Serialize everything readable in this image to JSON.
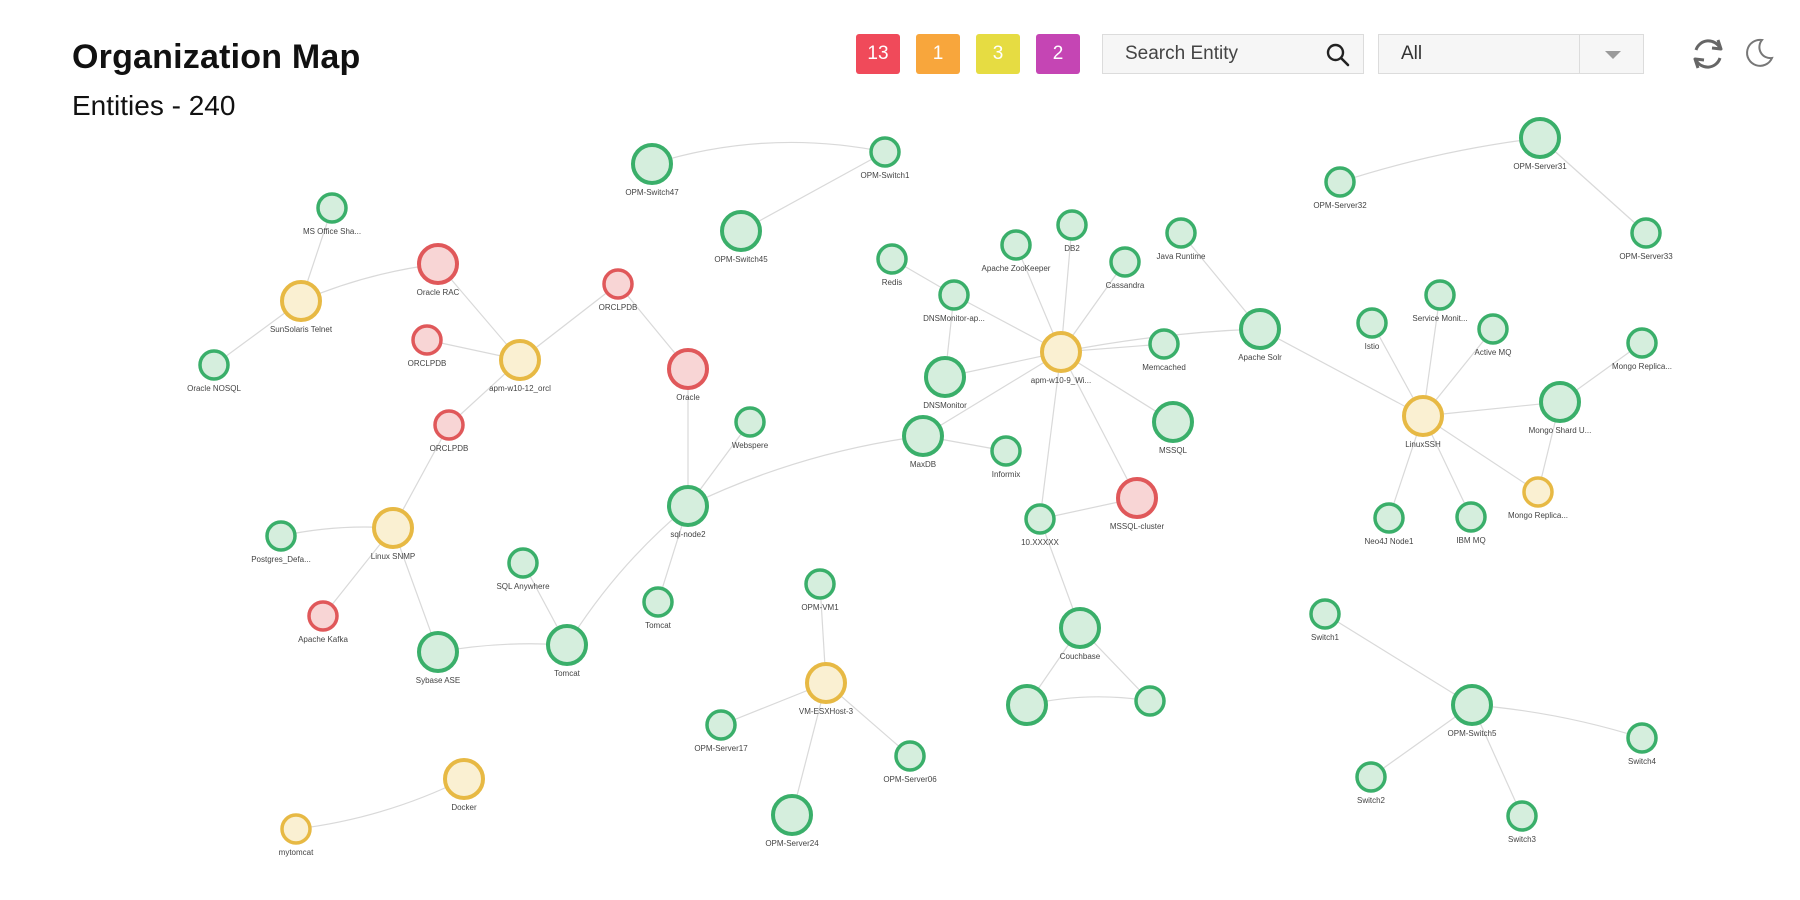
{
  "header": {
    "title": "Organization Map",
    "subtitle": "Entities - 240"
  },
  "status_counts": [
    {
      "value": "13",
      "color": "#f04a5a"
    },
    {
      "value": "1",
      "color": "#f8a63c"
    },
    {
      "value": "3",
      "color": "#e6dc42"
    },
    {
      "value": "2",
      "color": "#c545b4"
    }
  ],
  "search": {
    "placeholder": "Search Entity",
    "icon": "search-icon"
  },
  "filter": {
    "selected": "All",
    "icon": "chevron-down-icon"
  },
  "toolbar": {
    "refresh_icon": "refresh-icon",
    "theme_icon": "moon-icon"
  },
  "colors": {
    "green": "#3aaf6a",
    "green_fill": "#d5eedd",
    "red": "#e0585a",
    "red_fill": "#f8d5d5",
    "yellow": "#e7b944",
    "yellow_fill": "#faf0d2",
    "edge": "#d9d9d9"
  },
  "nodes": [
    {
      "id": "n1",
      "label": "OPM-Switch47",
      "status": "green"
    },
    {
      "id": "n2",
      "label": "OPM-Switch1",
      "status": "green"
    },
    {
      "id": "n3",
      "label": "OPM-Switch45",
      "status": "green"
    },
    {
      "id": "n4",
      "label": "MS Office Sha...",
      "status": "green"
    },
    {
      "id": "n5",
      "label": "Oracle RAC",
      "status": "red"
    },
    {
      "id": "n6",
      "label": "SunSolaris Telnet",
      "status": "yellow"
    },
    {
      "id": "n7",
      "label": "Oracle NOSQL",
      "status": "green"
    },
    {
      "id": "n8",
      "label": "ORCLPDB",
      "status": "red"
    },
    {
      "id": "n9",
      "label": "apm-w10-12_orcl",
      "status": "yellow"
    },
    {
      "id": "n10",
      "label": "ORCLPDB",
      "status": "red"
    },
    {
      "id": "n11",
      "label": "Oracle",
      "status": "red"
    },
    {
      "id": "n12",
      "label": "ORCLPDB",
      "status": "red"
    },
    {
      "id": "n13",
      "label": "Linux SNMP",
      "status": "yellow"
    },
    {
      "id": "n14",
      "label": "Postgres_Defa...",
      "status": "green"
    },
    {
      "id": "n15",
      "label": "Apache Kafka",
      "status": "red"
    },
    {
      "id": "n16",
      "label": "Sybase ASE",
      "status": "green"
    },
    {
      "id": "n17",
      "label": "SQL Anywhere",
      "status": "green"
    },
    {
      "id": "n18",
      "label": "Tomcat",
      "status": "green"
    },
    {
      "id": "n19",
      "label": "sql-node2",
      "status": "green"
    },
    {
      "id": "n20",
      "label": "Webspere",
      "status": "green"
    },
    {
      "id": "n21",
      "label": "Tomcat",
      "status": "green"
    },
    {
      "id": "n22",
      "label": "Docker",
      "status": "yellow"
    },
    {
      "id": "n23",
      "label": "mytomcat",
      "status": "yellow"
    },
    {
      "id": "n24",
      "label": "Redis",
      "status": "green"
    },
    {
      "id": "n25",
      "label": "Apache ZooKeeper",
      "status": "green"
    },
    {
      "id": "n26",
      "label": "DB2",
      "status": "green"
    },
    {
      "id": "n27",
      "label": "Cassandra",
      "status": "green"
    },
    {
      "id": "n28",
      "label": "Java Runtime",
      "status": "green"
    },
    {
      "id": "n29",
      "label": "DNSMonitor-ap...",
      "status": "green"
    },
    {
      "id": "n30",
      "label": "apm-w10-9_Wi...",
      "status": "yellow"
    },
    {
      "id": "n31",
      "label": "Memcached",
      "status": "green"
    },
    {
      "id": "n32",
      "label": "Apache Solr",
      "status": "green"
    },
    {
      "id": "n33",
      "label": "DNSMonitor",
      "status": "green"
    },
    {
      "id": "n34",
      "label": "MaxDB",
      "status": "green"
    },
    {
      "id": "n35",
      "label": "Informix",
      "status": "green"
    },
    {
      "id": "n36",
      "label": "MSSQL",
      "status": "green"
    },
    {
      "id": "n37",
      "label": "MSSQL-cluster",
      "status": "red"
    },
    {
      "id": "n38",
      "label": "10.XXXXX",
      "status": "green"
    },
    {
      "id": "n39",
      "label": "Couchbase",
      "status": "green"
    },
    {
      "id": "n40",
      "label": "",
      "status": "green"
    },
    {
      "id": "n41",
      "label": "",
      "status": "green"
    },
    {
      "id": "n42",
      "label": "OPM-VM1",
      "status": "green"
    },
    {
      "id": "n43",
      "label": "VM-ESXHost-3",
      "status": "yellow"
    },
    {
      "id": "n44",
      "label": "OPM-Server17",
      "status": "green"
    },
    {
      "id": "n45",
      "label": "OPM-Server06",
      "status": "green"
    },
    {
      "id": "n46",
      "label": "OPM-Server24",
      "status": "green"
    },
    {
      "id": "n47",
      "label": "OPM-Server32",
      "status": "green"
    },
    {
      "id": "n48",
      "label": "OPM-Server31",
      "status": "green"
    },
    {
      "id": "n49",
      "label": "OPM-Server33",
      "status": "green"
    },
    {
      "id": "n50",
      "label": "Istio",
      "status": "green"
    },
    {
      "id": "n51",
      "label": "Service Monit...",
      "status": "green"
    },
    {
      "id": "n52",
      "label": "Active MQ",
      "status": "green"
    },
    {
      "id": "n53",
      "label": "Mongo Replica...",
      "status": "green"
    },
    {
      "id": "n54",
      "label": "LinuxSSH",
      "status": "yellow"
    },
    {
      "id": "n55",
      "label": "Mongo Shard U...",
      "status": "green"
    },
    {
      "id": "n56",
      "label": "Neo4J Node1",
      "status": "green"
    },
    {
      "id": "n57",
      "label": "IBM MQ",
      "status": "green"
    },
    {
      "id": "n58",
      "label": "Mongo Replica...",
      "status": "yellow"
    },
    {
      "id": "n59",
      "label": "Switch1",
      "status": "green"
    },
    {
      "id": "n60",
      "label": "OPM-Switch5",
      "status": "green"
    },
    {
      "id": "n61",
      "label": "Switch4",
      "status": "green"
    },
    {
      "id": "n62",
      "label": "Switch2",
      "status": "green"
    },
    {
      "id": "n63",
      "label": "Switch3",
      "status": "green"
    }
  ]
}
